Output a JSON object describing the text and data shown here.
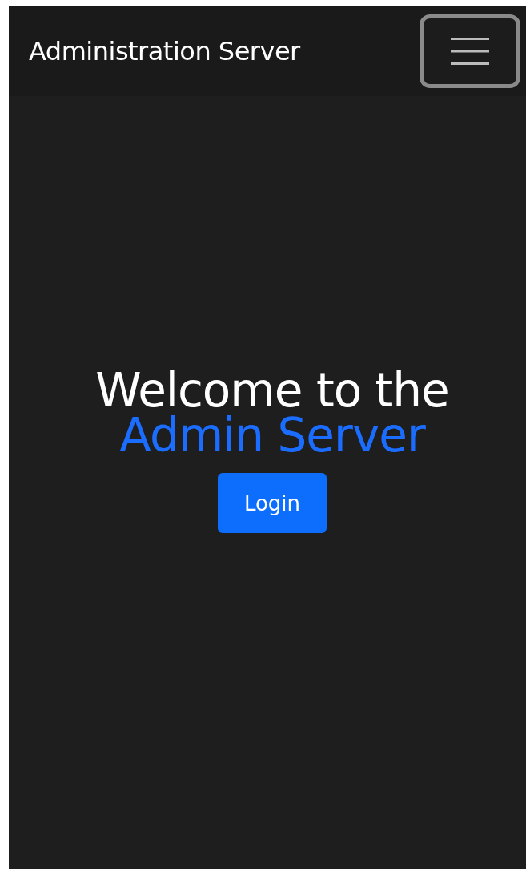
{
  "navbar": {
    "brand": "Administration Server"
  },
  "hero": {
    "heading": "Welcome to the",
    "highlight": "Admin Server",
    "button": "Login"
  }
}
